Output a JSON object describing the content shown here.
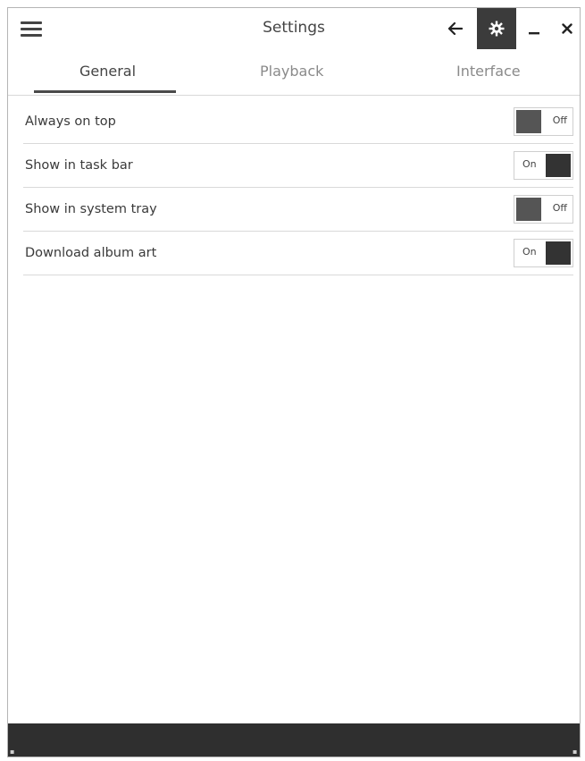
{
  "titlebar": {
    "title": "Settings",
    "icons": {
      "menu": "hamburger-icon",
      "back": "arrow-left-icon",
      "settings": "gear-icon",
      "minimize": "minimize-icon",
      "close": "close-icon"
    }
  },
  "tabs": [
    {
      "label": "General",
      "active": true
    },
    {
      "label": "Playback",
      "active": false
    },
    {
      "label": "Interface",
      "active": false
    }
  ],
  "settings": [
    {
      "label": "Always on top",
      "state": "Off"
    },
    {
      "label": "Show in task bar",
      "state": "On"
    },
    {
      "label": "Show in system tray",
      "state": "Off"
    },
    {
      "label": "Download album art",
      "state": "On"
    }
  ],
  "colors": {
    "accent_dark": "#3b3b3b",
    "statusbar": "#2f2f2f",
    "toggle_off_knob": "#555555",
    "toggle_on_knob": "#333333"
  }
}
